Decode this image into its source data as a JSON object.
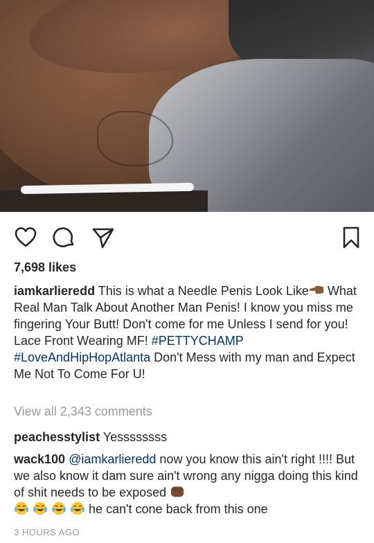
{
  "post": {
    "likes": "7,698 likes",
    "caption": {
      "username": "iamkarlieredd",
      "text_part1": " This is what a Needle Penis Look Like",
      "emoji_point": "backhand-index-pointing-left-emoji",
      "text_part2": " What Real Man Talk About Another Man Penis! I know you miss me fingering Your Butt! Don't come for me Unless I send for you! Lace Front Wearing MF! ",
      "hashtag1": "#PETTYCHAMP",
      "space": " ",
      "hashtag2": "#LoveAndHipHopAtlanta",
      "text_part3": " Don't Mess with my man and Expect Me Not To Come For U!"
    },
    "view_all_comments": "View all 2,343 comments",
    "comments": [
      {
        "username": "peachesstylist",
        "text": " Yessssssss"
      },
      {
        "username": "wack100",
        "mention": "@iamkarlieredd",
        "text": " now you know this ain't right !!!! But we also know it dam sure ain't wrong any nigga doing this kind of shit needs to be exposed ",
        "emoji_fist": "oncoming-fist-emoji",
        "emoji_laugh": "face-with-tears-of-joy-emoji",
        "text_end": " he can't cone back from this one"
      }
    ],
    "timestamp": "3 HOURS AGO"
  },
  "icons": {
    "like": "heart-icon",
    "comment": "comment-bubble-icon",
    "share": "paper-plane-icon",
    "save": "bookmark-icon"
  },
  "colors": {
    "text": "#262626",
    "hashtag": "#003569",
    "muted": "#999999"
  }
}
